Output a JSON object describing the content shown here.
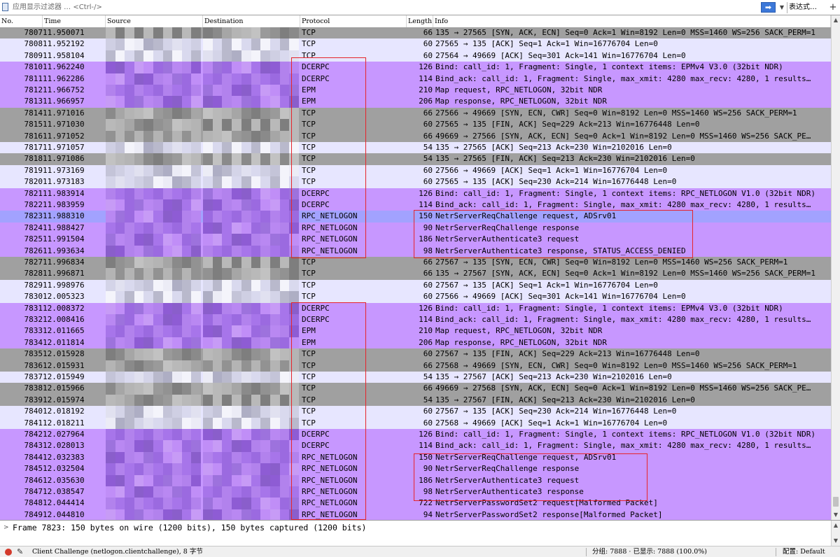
{
  "filter": {
    "placeholder": "应用显示过滤器 … <Ctrl-/>",
    "expression_label": "表达式…",
    "plus_label": "+",
    "apply_icon": "arrow-right-icon"
  },
  "columns": {
    "no": "No.",
    "time": "Time",
    "source": "Source",
    "destination": "Destination",
    "protocol": "Protocol",
    "length": "Length",
    "info": "Info"
  },
  "colors": {
    "tcp_gray": "#a0a0a0",
    "tcp_light": "#e7e6ff",
    "rpc_purple": "#c797ff",
    "selected": "#a2a2ff",
    "annotation_red": "#e6242b",
    "status_dot": "#d33a2c"
  },
  "packets": [
    {
      "no": "7807",
      "time": "11.950071",
      "protocol": "TCP",
      "length": "66",
      "info": "135 → 27565 [SYN, ACK, ECN] Seq=0 Ack=1 Win=8192 Len=0 MSS=1460 WS=256 SACK_PERM=1",
      "color": "tcp-a"
    },
    {
      "no": "7808",
      "time": "11.952192",
      "protocol": "TCP",
      "length": "60",
      "info": "27565 → 135 [ACK] Seq=1 Ack=1 Win=16776704 Len=0",
      "color": "tcp-b"
    },
    {
      "no": "7809",
      "time": "11.958104",
      "protocol": "TCP",
      "length": "60",
      "info": "27564 → 49669 [ACK] Seq=301 Ack=141 Win=16776704 Len=0",
      "color": "tcp-b"
    },
    {
      "no": "7810",
      "time": "11.962240",
      "protocol": "DCERPC",
      "length": "126",
      "info": "Bind: call_id: 1, Fragment: Single, 1 context items: EPMv4 V3.0 (32bit NDR)",
      "color": "rpc"
    },
    {
      "no": "7811",
      "time": "11.962286",
      "protocol": "DCERPC",
      "length": "114",
      "info": "Bind_ack: call_id: 1, Fragment: Single, max_xmit: 4280 max_recv: 4280, 1 results…",
      "color": "rpc"
    },
    {
      "no": "7812",
      "time": "11.966752",
      "protocol": "EPM",
      "length": "210",
      "info": "Map request, RPC_NETLOGON, 32bit NDR",
      "color": "rpc"
    },
    {
      "no": "7813",
      "time": "11.966957",
      "protocol": "EPM",
      "length": "206",
      "info": "Map response, RPC_NETLOGON, 32bit NDR",
      "color": "rpc"
    },
    {
      "no": "7814",
      "time": "11.971016",
      "protocol": "TCP",
      "length": "66",
      "info": "27566 → 49669 [SYN, ECN, CWR] Seq=0 Win=8192 Len=0 MSS=1460 WS=256 SACK_PERM=1",
      "color": "tcp-a"
    },
    {
      "no": "7815",
      "time": "11.971030",
      "protocol": "TCP",
      "length": "60",
      "info": "27565 → 135 [FIN, ACK] Seq=229 Ack=213 Win=16776448 Len=0",
      "color": "tcp-a"
    },
    {
      "no": "7816",
      "time": "11.971052",
      "protocol": "TCP",
      "length": "66",
      "info": "49669 → 27566 [SYN, ACK, ECN] Seq=0 Ack=1 Win=8192 Len=0 MSS=1460 WS=256 SACK_PE…",
      "color": "tcp-a"
    },
    {
      "no": "7817",
      "time": "11.971057",
      "protocol": "TCP",
      "length": "54",
      "info": "135 → 27565 [ACK] Seq=213 Ack=230 Win=2102016 Len=0",
      "color": "tcp-b"
    },
    {
      "no": "7818",
      "time": "11.971086",
      "protocol": "TCP",
      "length": "54",
      "info": "135 → 27565 [FIN, ACK] Seq=213 Ack=230 Win=2102016 Len=0",
      "color": "tcp-a"
    },
    {
      "no": "7819",
      "time": "11.973169",
      "protocol": "TCP",
      "length": "60",
      "info": "27566 → 49669 [ACK] Seq=1 Ack=1 Win=16776704 Len=0",
      "color": "tcp-b"
    },
    {
      "no": "7820",
      "time": "11.973183",
      "protocol": "TCP",
      "length": "60",
      "info": "27565 → 135 [ACK] Seq=230 Ack=214 Win=16776448 Len=0",
      "color": "tcp-b"
    },
    {
      "no": "7821",
      "time": "11.983914",
      "protocol": "DCERPC",
      "length": "126",
      "info": "Bind: call_id: 1, Fragment: Single, 1 context items: RPC_NETLOGON V1.0 (32bit NDR)",
      "color": "rpc"
    },
    {
      "no": "7822",
      "time": "11.983959",
      "protocol": "DCERPC",
      "length": "114",
      "info": "Bind_ack: call_id: 1, Fragment: Single, max_xmit: 4280 max_recv: 4280, 1 results…",
      "color": "rpc"
    },
    {
      "no": "7823",
      "time": "11.988310",
      "protocol": "RPC_NETLOGON",
      "length": "150",
      "info": "NetrServerReqChallenge request, ADSrv01",
      "color": "selected"
    },
    {
      "no": "7824",
      "time": "11.988427",
      "protocol": "RPC_NETLOGON",
      "length": "90",
      "info": "NetrServerReqChallenge response",
      "color": "rpc"
    },
    {
      "no": "7825",
      "time": "11.991504",
      "protocol": "RPC_NETLOGON",
      "length": "186",
      "info": "NetrServerAuthenticate3 request",
      "color": "rpc"
    },
    {
      "no": "7826",
      "time": "11.993634",
      "protocol": "RPC_NETLOGON",
      "length": "98",
      "info": "NetrServerAuthenticate3 response, STATUS_ACCESS_DENIED",
      "color": "rpc"
    },
    {
      "no": "7827",
      "time": "11.996834",
      "protocol": "TCP",
      "length": "66",
      "info": "27567 → 135 [SYN, ECN, CWR] Seq=0 Win=8192 Len=0 MSS=1460 WS=256 SACK_PERM=1",
      "color": "tcp-a"
    },
    {
      "no": "7828",
      "time": "11.996871",
      "protocol": "TCP",
      "length": "66",
      "info": "135 → 27567 [SYN, ACK, ECN] Seq=0 Ack=1 Win=8192 Len=0 MSS=1460 WS=256 SACK_PERM=1",
      "color": "tcp-a"
    },
    {
      "no": "7829",
      "time": "11.998976",
      "protocol": "TCP",
      "length": "60",
      "info": "27567 → 135 [ACK] Seq=1 Ack=1 Win=16776704 Len=0",
      "color": "tcp-b"
    },
    {
      "no": "7830",
      "time": "12.005323",
      "protocol": "TCP",
      "length": "60",
      "info": "27566 → 49669 [ACK] Seq=301 Ack=141 Win=16776704 Len=0",
      "color": "tcp-b"
    },
    {
      "no": "7831",
      "time": "12.008372",
      "protocol": "DCERPC",
      "length": "126",
      "info": "Bind: call_id: 1, Fragment: Single, 1 context items: EPMv4 V3.0 (32bit NDR)",
      "color": "rpc"
    },
    {
      "no": "7832",
      "time": "12.008416",
      "protocol": "DCERPC",
      "length": "114",
      "info": "Bind_ack: call_id: 1, Fragment: Single, max_xmit: 4280 max_recv: 4280, 1 results…",
      "color": "rpc"
    },
    {
      "no": "7833",
      "time": "12.011665",
      "protocol": "EPM",
      "length": "210",
      "info": "Map request, RPC_NETLOGON, 32bit NDR",
      "color": "rpc"
    },
    {
      "no": "7834",
      "time": "12.011814",
      "protocol": "EPM",
      "length": "206",
      "info": "Map response, RPC_NETLOGON, 32bit NDR",
      "color": "rpc"
    },
    {
      "no": "7835",
      "time": "12.015928",
      "protocol": "TCP",
      "length": "60",
      "info": "27567 → 135 [FIN, ACK] Seq=229 Ack=213 Win=16776448 Len=0",
      "color": "tcp-a"
    },
    {
      "no": "7836",
      "time": "12.015931",
      "protocol": "TCP",
      "length": "66",
      "info": "27568 → 49669 [SYN, ECN, CWR] Seq=0 Win=8192 Len=0 MSS=1460 WS=256 SACK_PERM=1",
      "color": "tcp-a"
    },
    {
      "no": "7837",
      "time": "12.015949",
      "protocol": "TCP",
      "length": "54",
      "info": "135 → 27567 [ACK] Seq=213 Ack=230 Win=2102016 Len=0",
      "color": "tcp-b"
    },
    {
      "no": "7838",
      "time": "12.015966",
      "protocol": "TCP",
      "length": "66",
      "info": "49669 → 27568 [SYN, ACK, ECN] Seq=0 Ack=1 Win=8192 Len=0 MSS=1460 WS=256 SACK_PE…",
      "color": "tcp-a"
    },
    {
      "no": "7839",
      "time": "12.015974",
      "protocol": "TCP",
      "length": "54",
      "info": "135 → 27567 [FIN, ACK] Seq=213 Ack=230 Win=2102016 Len=0",
      "color": "tcp-a"
    },
    {
      "no": "7840",
      "time": "12.018192",
      "protocol": "TCP",
      "length": "60",
      "info": "27567 → 135 [ACK] Seq=230 Ack=214 Win=16776448 Len=0",
      "color": "tcp-b"
    },
    {
      "no": "7841",
      "time": "12.018211",
      "protocol": "TCP",
      "length": "60",
      "info": "27568 → 49669 [ACK] Seq=1 Ack=1 Win=16776704 Len=0",
      "color": "tcp-b"
    },
    {
      "no": "7842",
      "time": "12.027964",
      "protocol": "DCERPC",
      "length": "126",
      "info": "Bind: call_id: 1, Fragment: Single, 1 context items: RPC_NETLOGON V1.0 (32bit NDR)",
      "color": "rpc"
    },
    {
      "no": "7843",
      "time": "12.028013",
      "protocol": "DCERPC",
      "length": "114",
      "info": "Bind_ack: call_id: 1, Fragment: Single, max_xmit: 4280 max_recv: 4280, 1 results…",
      "color": "rpc"
    },
    {
      "no": "7844",
      "time": "12.032383",
      "protocol": "RPC_NETLOGON",
      "length": "150",
      "info": "NetrServerReqChallenge request, ADSrv01",
      "color": "rpc"
    },
    {
      "no": "7845",
      "time": "12.032504",
      "protocol": "RPC_NETLOGON",
      "length": "90",
      "info": "NetrServerReqChallenge response",
      "color": "rpc"
    },
    {
      "no": "7846",
      "time": "12.035630",
      "protocol": "RPC_NETLOGON",
      "length": "186",
      "info": "NetrServerAuthenticate3 request",
      "color": "rpc"
    },
    {
      "no": "7847",
      "time": "12.038547",
      "protocol": "RPC_NETLOGON",
      "length": "98",
      "info": "NetrServerAuthenticate3 response",
      "color": "rpc"
    },
    {
      "no": "7848",
      "time": "12.044414",
      "protocol": "RPC_NETLOGON",
      "length": "722",
      "info": "NetrServerPasswordSet2 request[Malformed Packet]",
      "color": "rpc"
    },
    {
      "no": "7849",
      "time": "12.044810",
      "protocol": "RPC_NETLOGON",
      "length": "94",
      "info": "NetrServerPasswordSet2 response[Malformed Packet]",
      "color": "rpc"
    }
  ],
  "details": {
    "frame_summary": "Frame 7823: 150 bytes on wire (1200 bits), 150 bytes captured (1200 bits)"
  },
  "status": {
    "field_info": "Client Challenge (netlogon.clientchallenge), 8 字节",
    "packets": "分组: 7888 · 已显示: 7888 (100.0%)",
    "profile": "配置: Default"
  }
}
